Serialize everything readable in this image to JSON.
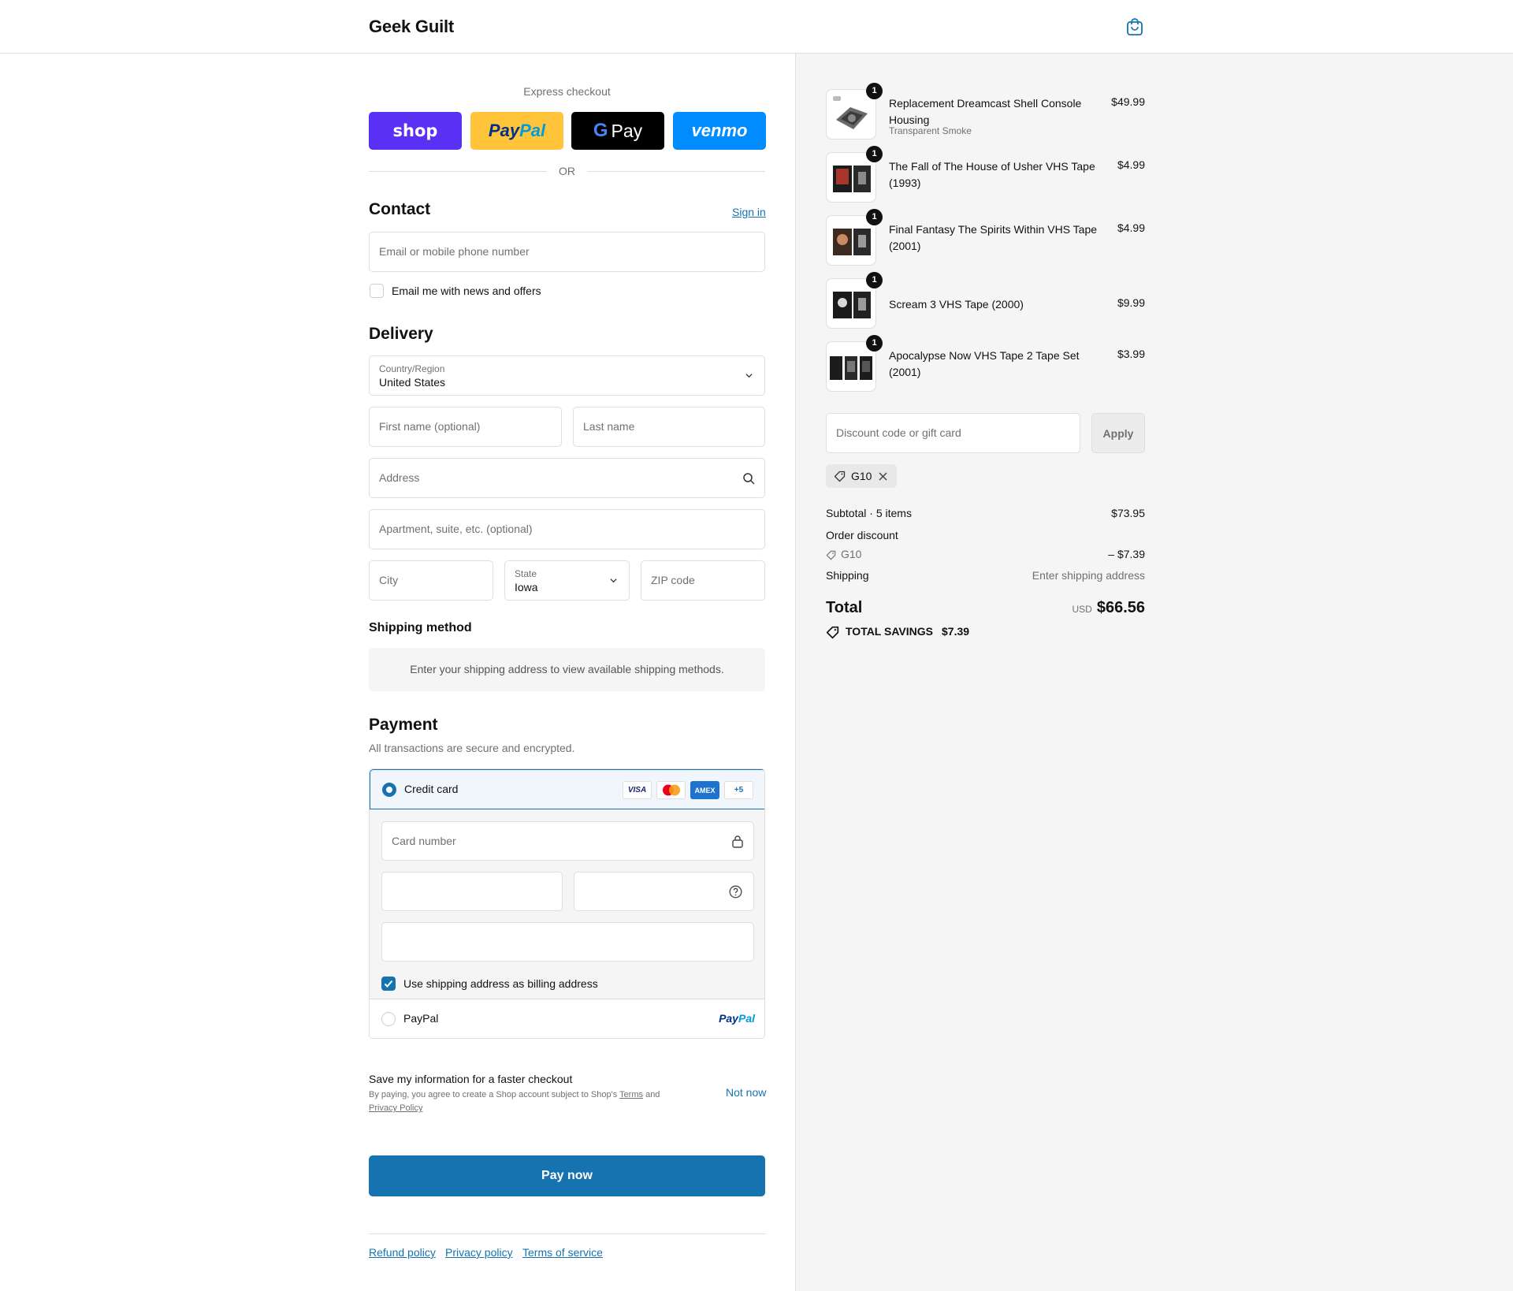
{
  "header": {
    "store_name": "Geek Guilt"
  },
  "express": {
    "label": "Express checkout",
    "shop": "shop",
    "paypal_a": "Pay",
    "paypal_b": "Pal",
    "gpay_g": "G",
    "gpay": "Pay",
    "venmo": "venmo",
    "or": "OR"
  },
  "contact": {
    "title": "Contact",
    "sign_in": "Sign in",
    "email_placeholder": "Email or mobile phone number",
    "news_label": "Email me with news and offers"
  },
  "delivery": {
    "title": "Delivery",
    "country_label": "Country/Region",
    "country_value": "United States",
    "first_name_placeholder": "First name (optional)",
    "last_name_placeholder": "Last name",
    "address_placeholder": "Address",
    "apartment_placeholder": "Apartment, suite, etc. (optional)",
    "city_placeholder": "City",
    "state_label": "State",
    "state_value": "Iowa",
    "zip_placeholder": "ZIP code"
  },
  "shipping_method": {
    "title": "Shipping method",
    "message": "Enter your shipping address to view available shipping methods."
  },
  "payment": {
    "title": "Payment",
    "subtitle": "All transactions are secure and encrypted.",
    "credit_card_label": "Credit card",
    "card_logos": [
      "VISA",
      "",
      "AMEX",
      "+5"
    ],
    "card_number_placeholder": "Card number",
    "billing_same_label": "Use shipping address as billing address",
    "paypal_label": "PayPal",
    "paypal_logo_a": "Pay",
    "paypal_logo_b": "Pal"
  },
  "save_info": {
    "title": "Save my information for a faster checkout",
    "text_a": "By paying, you agree to create a Shop account subject to Shop's ",
    "terms": "Terms",
    "text_b": " and ",
    "privacy": "Privacy Policy",
    "not_now": "Not now"
  },
  "pay_now": "Pay now",
  "footer": {
    "links": [
      "Refund policy",
      "Privacy policy",
      "Terms of service"
    ]
  },
  "order": {
    "items": [
      {
        "name": "Replacement Dreamcast Shell Console Housing",
        "variant": "Transparent Smoke",
        "price": "$49.99",
        "qty": "1"
      },
      {
        "name": "The Fall of The House of Usher VHS Tape (1993)",
        "variant": "",
        "price": "$4.99",
        "qty": "1"
      },
      {
        "name": "Final Fantasy The Spirits Within VHS Tape (2001)",
        "variant": "",
        "price": "$4.99",
        "qty": "1"
      },
      {
        "name": "Scream 3 VHS Tape (2000)",
        "variant": "",
        "price": "$9.99",
        "qty": "1"
      },
      {
        "name": "Apocalypse Now VHS Tape 2 Tape Set (2001)",
        "variant": "",
        "price": "$3.99",
        "qty": "1"
      }
    ],
    "discount_placeholder": "Discount code or gift card",
    "apply": "Apply",
    "applied_code": "G10",
    "subtotal_label": "Subtotal · 5 items",
    "subtotal_value": "$73.95",
    "order_discount_label": "Order discount",
    "discount_code": "G10",
    "discount_value": "– $7.39",
    "shipping_label": "Shipping",
    "shipping_value": "Enter shipping address",
    "total_label": "Total",
    "currency": "USD",
    "total_value": "$66.56",
    "savings_label": "TOTAL SAVINGS",
    "savings_value": "$7.39"
  },
  "colors": {
    "accent": "#1773b0",
    "shop_purple": "#5a31f4",
    "paypal_yellow": "#ffc439",
    "venmo_blue": "#008cff"
  }
}
